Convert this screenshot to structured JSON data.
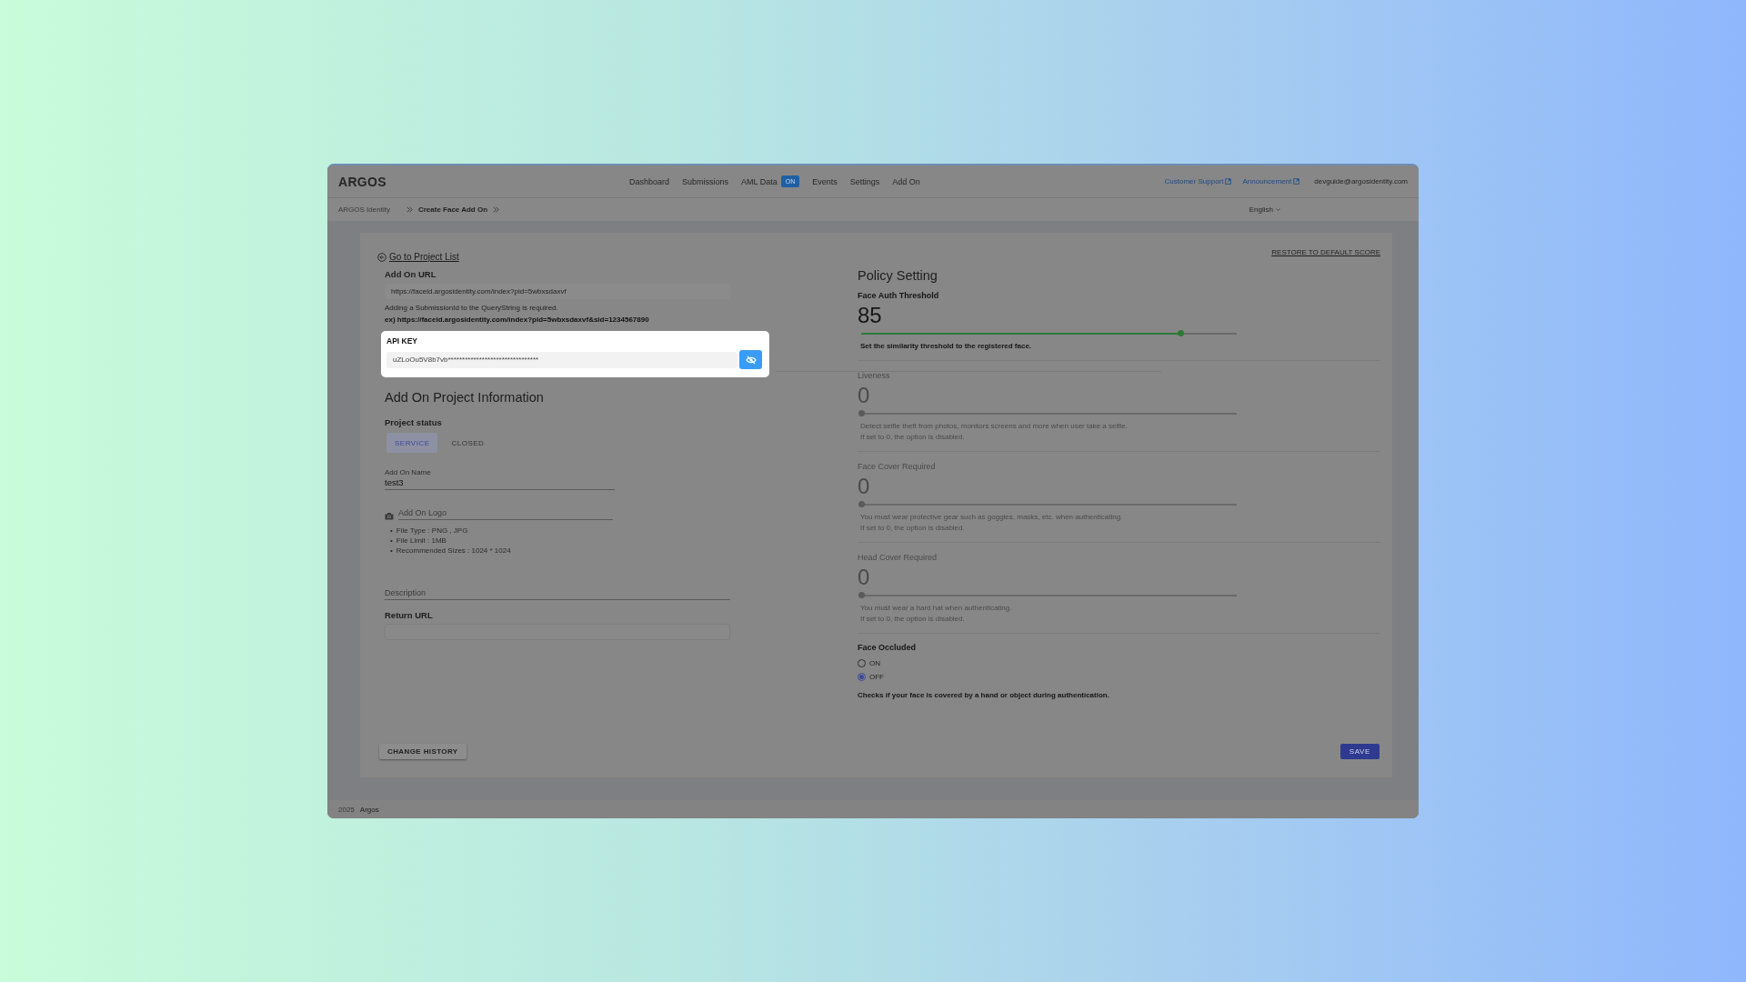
{
  "header": {
    "logo": "ARGOS",
    "nav": [
      {
        "label": "Dashboard"
      },
      {
        "label": "Submissions"
      },
      {
        "label": "AML Data",
        "badge": "ON"
      },
      {
        "label": "Events"
      },
      {
        "label": "Settings"
      },
      {
        "label": "Add On"
      }
    ],
    "links": [
      {
        "label": "Customer Support"
      },
      {
        "label": "Announcement"
      }
    ],
    "account": "devguide@argosidentity.com"
  },
  "breadcrumb": {
    "items": [
      "ARGOS Identity",
      "Create Face Add On"
    ],
    "language": "English"
  },
  "back_link": "Go to Project List",
  "addon_url": {
    "label": "Add On URL",
    "value": "https://faceid.argosidentity.com/index?pid=5wbxsdaxvf",
    "note": "Adding a SubmissionId to the QueryString is required.",
    "example": "ex) https://faceid.argosidentity.com/index?pid=5wbxsdaxvf&sid=1234567890"
  },
  "api_key": {
    "label": "API KEY",
    "value": "uZLoOu5V8b7vb********************************"
  },
  "project_info": {
    "title": "Add On Project Information",
    "status_label": "Project status",
    "status_options": [
      {
        "label": "SERVICE",
        "selected": true
      },
      {
        "label": "CLOSED",
        "selected": false
      }
    ],
    "name_field": {
      "label": "Add On Name",
      "value": "test3"
    },
    "logo_field": {
      "placeholder": "Add On Logo"
    },
    "logo_rules": [
      {
        "bullet": "•",
        "text": "File Type : PNG , JPG"
      },
      {
        "bullet": "•",
        "text": "File Limit : 1MB"
      },
      {
        "bullet": "•",
        "text": "Recommended Sizes : 1024 * 1024"
      }
    ],
    "description": {
      "placeholder": "Description"
    },
    "return_url": {
      "label": "Return URL"
    }
  },
  "policy": {
    "restore": "RESTORE TO DEFAULT SCORE",
    "title": "Policy Setting",
    "sliders": [
      {
        "name": "Face Auth Threshold",
        "value": "85",
        "level": 0.85,
        "disabled": false,
        "description": "Set the similarity threshold to the registered face."
      },
      {
        "name": "Liveness",
        "value": "0",
        "level": 0,
        "disabled": true,
        "description": "Detect selfie theft from photos, monitors screens and more when user take a selfie.",
        "hint": "If set to 0, the option is disabled."
      },
      {
        "name": "Face Cover Required",
        "value": "0",
        "level": 0,
        "disabled": true,
        "description": "You must wear protective gear such as goggles, masks, etc. when authenticating.",
        "hint": "If set to 0, the option is disabled."
      },
      {
        "name": "Head Cover Required",
        "value": "0",
        "level": 0,
        "disabled": true,
        "description": "You must wear a hard hat when authenticating.",
        "hint": "If set to 0, the option is disabled."
      }
    ],
    "occluded": {
      "title": "Face Occluded",
      "options": [
        {
          "label": "ON",
          "selected": false
        },
        {
          "label": "OFF",
          "selected": true
        }
      ],
      "description": "Checks if your face is covered by a hand or object during authentication."
    }
  },
  "buttons": {
    "history": "CHANGE HISTORY",
    "save": "SAVE"
  },
  "footer": {
    "year": "2025",
    "brand": "Argos"
  }
}
